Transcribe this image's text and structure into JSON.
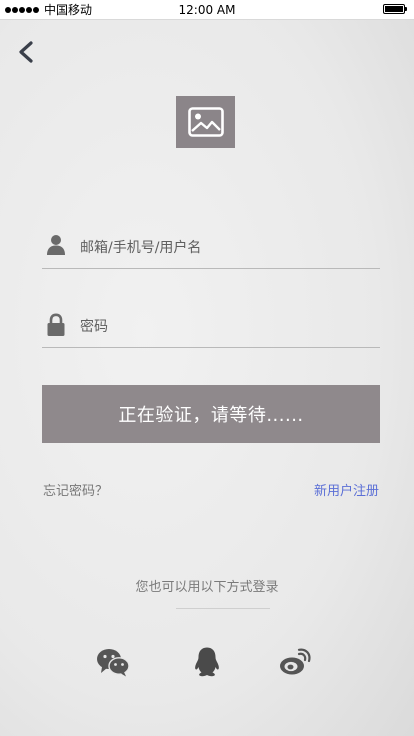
{
  "status_bar": {
    "carrier": "中国移动",
    "time": "12:00 AM",
    "battery_level": 1.0
  },
  "nav": {
    "back_icon": "chevron-left-icon"
  },
  "logo": {
    "icon": "image-placeholder-icon"
  },
  "form": {
    "username": {
      "icon": "user-icon",
      "placeholder": "邮箱/手机号/用户名",
      "value": ""
    },
    "password": {
      "icon": "lock-icon",
      "placeholder": "密码",
      "value": ""
    },
    "submit_label": "正在验证，请等待......",
    "forgot_label": "忘记密码？",
    "register_label": "新用户注册"
  },
  "alt_login": {
    "text": "您也可以用以下方式登录",
    "providers": [
      {
        "icon": "wechat-icon"
      },
      {
        "icon": "qq-icon"
      },
      {
        "icon": "weibo-icon"
      }
    ]
  },
  "colors": {
    "button_bg": "#8f898c",
    "link": "#5b6fd6",
    "logo_bg": "#8b8589"
  }
}
